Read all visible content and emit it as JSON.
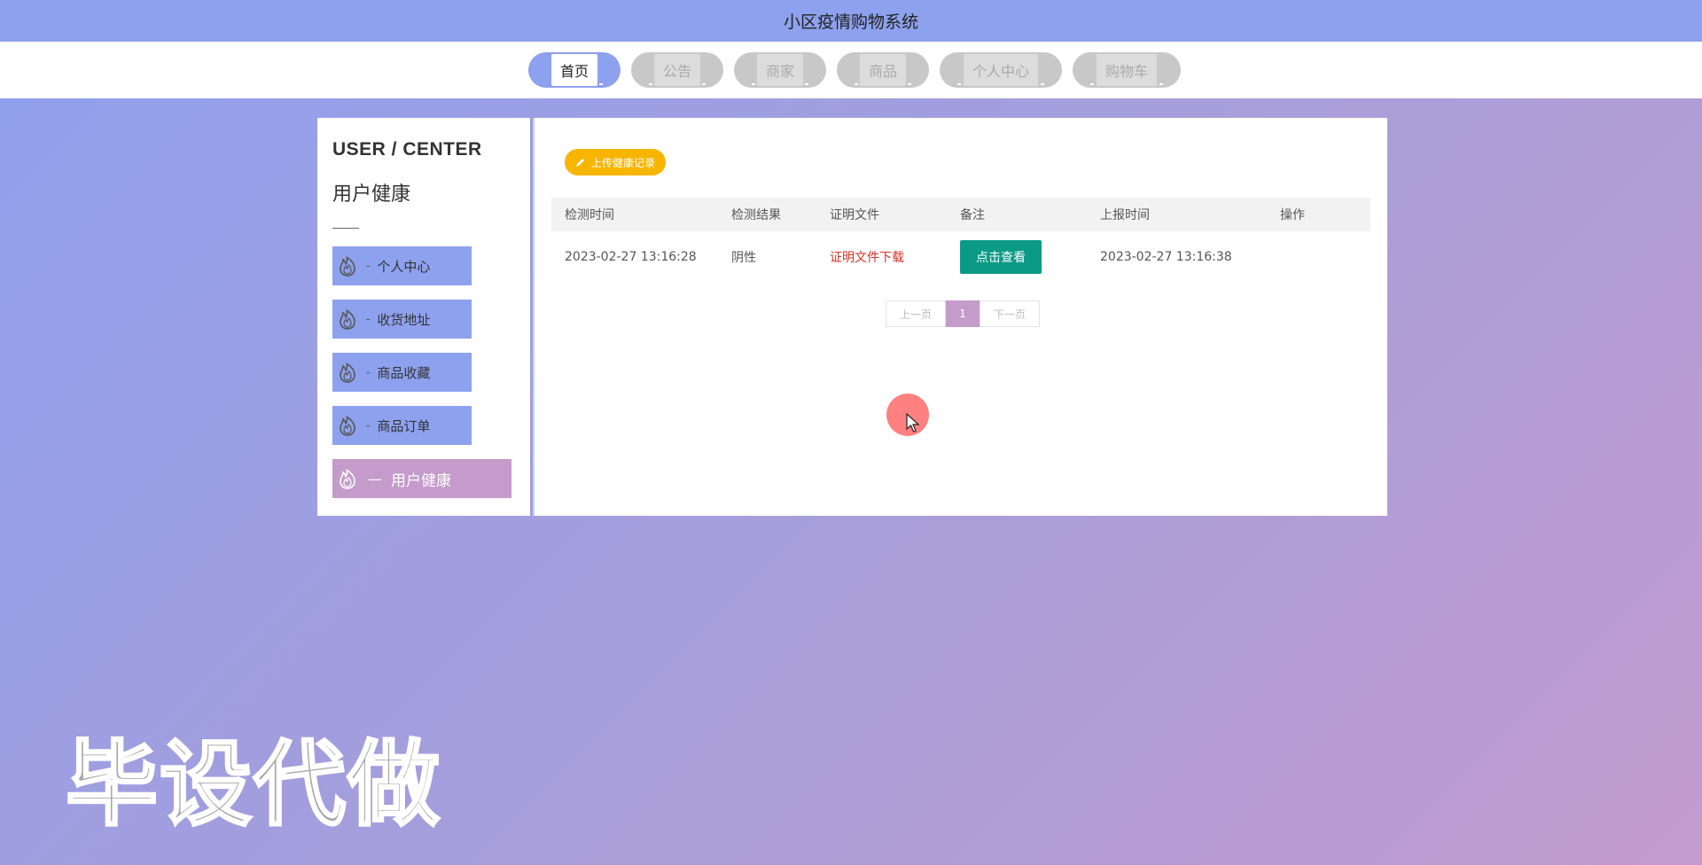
{
  "header": {
    "title": "小区疫情购物系统"
  },
  "nav": {
    "items": [
      {
        "label": "首页",
        "active": true
      },
      {
        "label": "公告",
        "active": false
      },
      {
        "label": "商家",
        "active": false
      },
      {
        "label": "商品",
        "active": false
      },
      {
        "label": "个人中心",
        "active": false
      },
      {
        "label": "购物车",
        "active": false
      }
    ]
  },
  "sidebar": {
    "title": "USER / CENTER",
    "subtitle": "用户健康",
    "items": [
      {
        "label": "个人中心",
        "dash": "-",
        "icon": "flame-icon"
      },
      {
        "label": "收货地址",
        "dash": "-",
        "icon": "flame-icon"
      },
      {
        "label": "商品收藏",
        "dash": "-",
        "icon": "flame-icon"
      },
      {
        "label": "商品订单",
        "dash": "-",
        "icon": "flame-icon"
      },
      {
        "label": "用户健康",
        "dash": "—",
        "icon": "flame-icon",
        "active": true
      }
    ]
  },
  "main": {
    "upload_label": "上传健康记录",
    "table": {
      "headers": [
        "检测时间",
        "检测结果",
        "证明文件",
        "备注",
        "上报时间",
        "操作"
      ],
      "rows": [
        {
          "test_time": "2023-02-27 13:16:28",
          "result": "阴性",
          "file_link": "证明文件下载",
          "remark_button": "点击查看",
          "report_time": "2023-02-27 13:16:38",
          "action": ""
        }
      ]
    },
    "pagination": {
      "prev": "上一页",
      "current": "1",
      "next": "下一页"
    }
  },
  "watermark": {
    "text": "毕设代做"
  },
  "colors": {
    "accent": "#8ea1ee",
    "active_purple": "#c49bcb",
    "upload_yellow": "#f7b500",
    "view_green": "#0a9a86",
    "link_red": "#d93025"
  }
}
